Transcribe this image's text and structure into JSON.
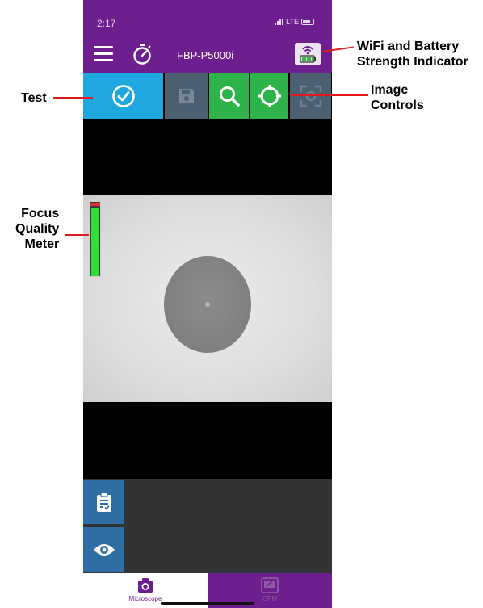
{
  "status_bar": {
    "time": "2:17",
    "network": "LTE"
  },
  "app_bar": {
    "menu_icon": "hamburger-menu-icon",
    "timer_icon": "stopwatch-icon",
    "device_name": "FBP-P5000i",
    "status_icon": "wifi-battery-icon"
  },
  "toolbar": {
    "buttons": [
      {
        "name": "test",
        "icon": "check-circle-icon",
        "color": "#1fa7df"
      },
      {
        "name": "save",
        "icon": "save-icon",
        "color": "#4c5f70"
      },
      {
        "name": "zoom",
        "icon": "search-icon",
        "color": "#2db34a"
      },
      {
        "name": "center",
        "icon": "crosshair-icon",
        "color": "#2db34a"
      },
      {
        "name": "capture",
        "icon": "focus-capture-icon",
        "color": "#4c5f70"
      }
    ]
  },
  "focus_meter": {
    "level": 0.92
  },
  "side_buttons": [
    {
      "name": "report",
      "icon": "clipboard-check-icon"
    },
    {
      "name": "view",
      "icon": "eye-icon"
    }
  ],
  "tabs": [
    {
      "label": "Microscope",
      "icon": "camera-icon",
      "active": true
    },
    {
      "label": "OPM",
      "icon": "meter-icon",
      "active": false
    }
  ],
  "annotations": {
    "wifi_battery_line1": "WiFi and Battery",
    "wifi_battery_line2": "Strength Indicator",
    "test": "Test",
    "image_controls_line1": "Image",
    "image_controls_line2": "Controls",
    "focus_line1": "Focus",
    "focus_line2": "Quality",
    "focus_line3": "Meter"
  },
  "colors": {
    "brand_purple": "#6d1f8f",
    "test_blue": "#1fa7df",
    "control_green": "#2db34a",
    "disabled_gray": "#4c5f70",
    "annotation_red": "#e01a1a"
  }
}
